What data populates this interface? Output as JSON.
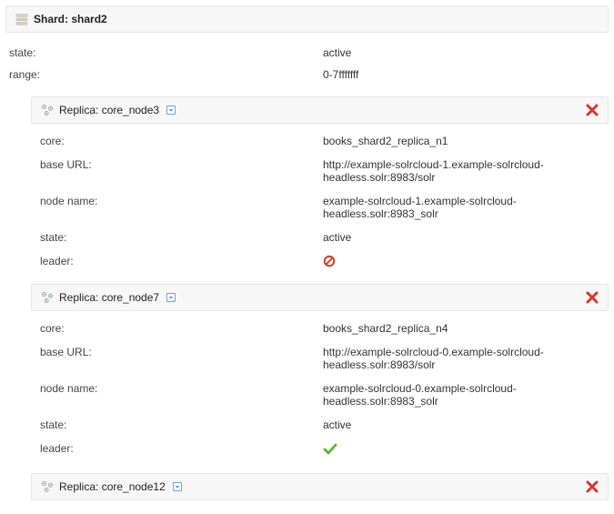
{
  "shard": {
    "title_prefix": "Shard: ",
    "name": "shard2",
    "state_label": "state:",
    "state_value": "active",
    "range_label": "range:",
    "range_value": "0-7fffffff"
  },
  "replica_prefix": "Replica: ",
  "labels": {
    "core": "core:",
    "base_url": "base URL:",
    "node_name": "node name:",
    "state": "state:",
    "leader": "leader:"
  },
  "replicas": [
    {
      "name": "core_node3",
      "core": "books_shard2_replica_n1",
      "base_url": "http://example-solrcloud-1.example-solrcloud-headless.solr:8983/solr",
      "node_name": "example-solrcloud-1.example-solrcloud-headless.solr:8983_solr",
      "state": "active",
      "leader": false
    },
    {
      "name": "core_node7",
      "core": "books_shard2_replica_n4",
      "base_url": "http://example-solrcloud-0.example-solrcloud-headless.solr:8983/solr",
      "node_name": "example-solrcloud-0.example-solrcloud-headless.solr:8983_solr",
      "state": "active",
      "leader": true
    },
    {
      "name": "core_node12"
    }
  ]
}
